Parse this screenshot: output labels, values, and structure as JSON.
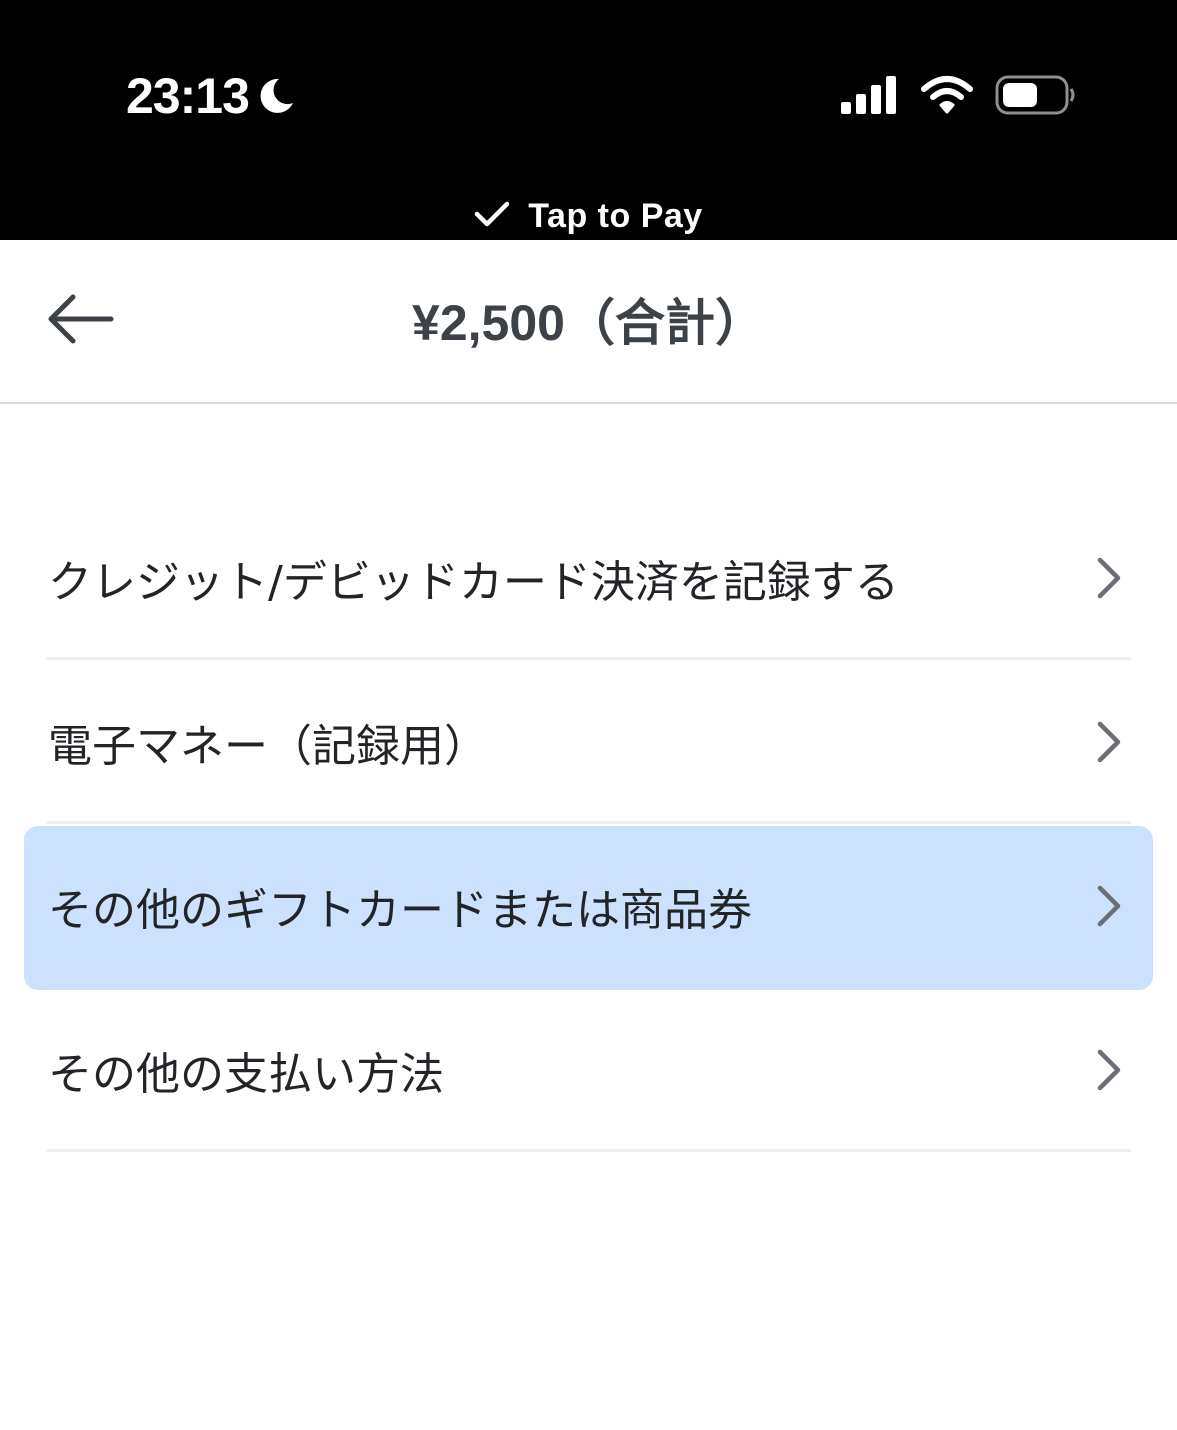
{
  "status_bar": {
    "time": "23:13",
    "moon_icon": "moon-icon",
    "signal_icon": "cellular-signal-icon",
    "wifi_icon": "wifi-icon",
    "battery_icon": "battery-icon",
    "battery_level": 0.45,
    "tap_to_pay_label": "Tap to Pay",
    "tap_to_pay_icon": "checkmark-icon"
  },
  "header": {
    "back_icon": "arrow-left-icon",
    "title": "¥2,500（合計）"
  },
  "menu": {
    "items": [
      {
        "label": "クレジット/デビッドカード決済を記録する",
        "icon": "chevron-right-icon",
        "highlighted": false
      },
      {
        "label": "電子マネー（記録用）",
        "icon": "chevron-right-icon",
        "highlighted": false
      },
      {
        "label": "その他のギフトカードまたは商品券",
        "icon": "chevron-right-icon",
        "highlighted": true
      },
      {
        "label": "その他の支払い方法",
        "icon": "chevron-right-icon",
        "highlighted": false
      }
    ]
  },
  "colors": {
    "status_bar_bg": "#000000",
    "title_text": "#3c4248",
    "highlight_bg": "#cce1fd",
    "divider": "#edeef0",
    "chevron": "#6b6f75"
  }
}
